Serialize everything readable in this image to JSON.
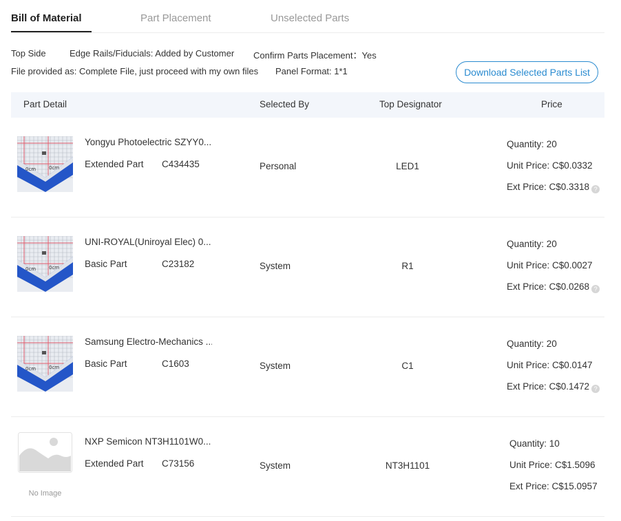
{
  "tabs": [
    {
      "label": "Bill of Material",
      "active": true
    },
    {
      "label": "Part Placement",
      "active": false
    },
    {
      "label": "Unselected Parts",
      "active": false
    }
  ],
  "info": {
    "side": "Top Side",
    "edge_rails": "Edge Rails/Fiducials: Added by Customer",
    "confirm_placement": "Confirm Parts Placement：Yes",
    "file_provided": "File provided as: Complete File, just proceed with my own files",
    "panel_format": "Panel Format: 1*1"
  },
  "download_button": "Download Selected Parts List",
  "table": {
    "headers": [
      "Part Detail",
      "Selected By",
      "Top Designator",
      "Price"
    ],
    "rows": [
      {
        "name": "Yongyu Photoelectric SZYY0...",
        "type": "Extended Part",
        "code": "C434435",
        "selected_by": "Personal",
        "designator": "LED1",
        "quantity": "Quantity: 20",
        "unit_price": "Unit Price: C$0.0332",
        "ext_price": "Ext Price: C$0.3318",
        "image": "component-photo"
      },
      {
        "name": "UNI-ROYAL(Uniroyal Elec) 0...",
        "type": "Basic Part",
        "code": "C23182",
        "selected_by": "System",
        "designator": "R1",
        "quantity": "Quantity: 20",
        "unit_price": "Unit Price: C$0.0027",
        "ext_price": "Ext Price: C$0.0268",
        "image": "component-photo"
      },
      {
        "name": "Samsung Electro-Mechanics ...",
        "type": "Basic Part",
        "code": "C1603",
        "selected_by": "System",
        "designator": "C1",
        "quantity": "Quantity: 20",
        "unit_price": "Unit Price: C$0.0147",
        "ext_price": "Ext Price: C$0.1472",
        "image": "component-photo"
      },
      {
        "name": "NXP Semicon NT3H1101W0...",
        "type": "Extended Part",
        "code": "C73156",
        "selected_by": "System",
        "designator": "NT3H1101",
        "quantity": "Quantity: 10",
        "unit_price": "Unit Price: C$1.5096",
        "ext_price": "Ext Price: C$15.0957",
        "image": "no-image",
        "no_image_label": "No Image"
      }
    ]
  },
  "help_glyph": "?",
  "colors": {
    "accent": "#2a8bd0",
    "header_bg": "#f3f6fb",
    "pcb_blue": "#2456c8",
    "grid_red": "#e05a6a"
  }
}
